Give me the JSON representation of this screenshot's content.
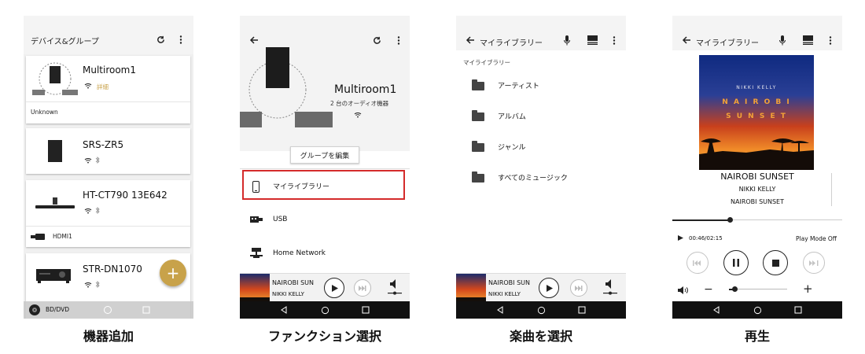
{
  "captions": [
    "機器追加",
    "ファンクション選択",
    "楽曲を選択",
    "再生"
  ],
  "screen1": {
    "title": "デバイス&グループ",
    "devices": [
      {
        "name": "Multiroom1",
        "detail": "詳細",
        "sub": "Unknown"
      },
      {
        "name": "SRS-ZR5"
      },
      {
        "name": "HT-CT790 13E642",
        "sub": "HDMI1"
      },
      {
        "name": "STR-DN1070",
        "sub": "BD/DVD"
      }
    ],
    "fab_label": "+",
    "detail_color": "#c8a24a"
  },
  "screen2": {
    "group_name": "Multiroom1",
    "group_sub": "2 台のオーディオ機器",
    "edit_button": "グループを編集",
    "menu": [
      "マイライブラリー",
      "USB",
      "Home Network"
    ],
    "highlight_color": "#d42b2b",
    "mini_title": "NAIROBI SUN",
    "mini_artist": "NIKKI KELLY"
  },
  "screen3": {
    "title": "マイライブラリー",
    "section": "マイライブラリー",
    "items": [
      "アーティスト",
      "アルバム",
      "ジャンル",
      "すべてのミュージック"
    ],
    "mini_title": "NAIROBI SUN",
    "mini_artist": "NIKKI KELLY"
  },
  "screen4": {
    "title": "マイライブラリー",
    "album_artist": "NIKKI KELLY",
    "album_line1": "N A I R O B I",
    "album_line2": "S U N S E T",
    "track": "NAIROBI SUNSET",
    "artist": "NIKKI KELLY",
    "album": "NAIROBI SUNSET",
    "time": "00:46/02:15",
    "play_mode": "Play Mode Off",
    "progress": 0.34,
    "volume_minus": "−",
    "volume_plus": "+"
  }
}
